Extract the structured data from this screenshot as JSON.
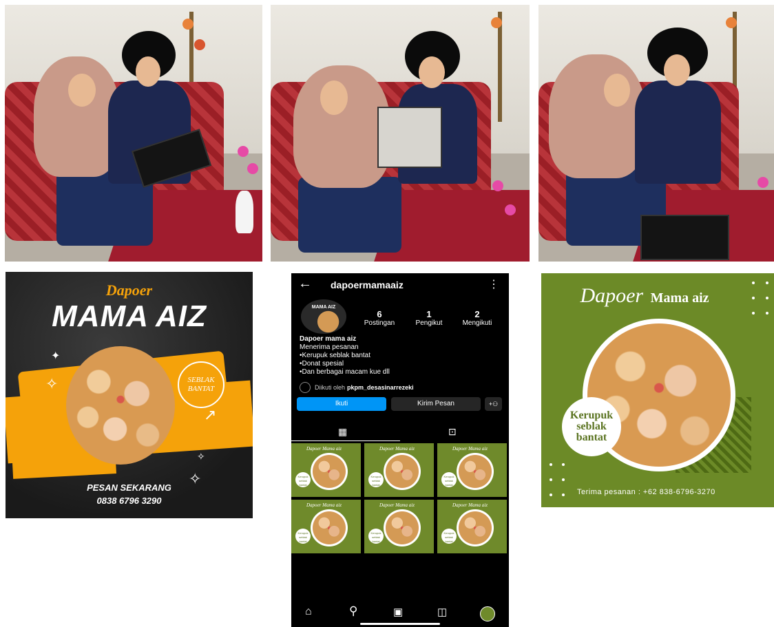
{
  "poster1": {
    "script_title": "Dapoer",
    "title": "MAMA AIZ",
    "badge": "SEBLAK BANTAT",
    "cta": "PESAN SEKARANG",
    "phone": "0838 6796 3290"
  },
  "instagram": {
    "username": "dapoermamaaiz",
    "avatar_text": "MAMA AIZ",
    "stats": [
      {
        "value": "6",
        "label": "Postingan"
      },
      {
        "value": "1",
        "label": "Pengikut"
      },
      {
        "value": "2",
        "label": "Mengikuti"
      }
    ],
    "bio_name": "Dapoer mama aiz",
    "bio_lines": [
      "Menerima pesanan",
      "•Kerupuk seblak bantat",
      "•Donat spesial",
      "•Dan berbagai macam kue dll"
    ],
    "followed_by_prefix": "Diikuti oleh",
    "followed_by_user": "pkpm_desasinarrezeki",
    "follow_button": "Ikuti",
    "message_button": "Kirim Pesan",
    "tile_title": "Dapoer Mama aiz",
    "tile_badge": "Kerupuk seblak bantat"
  },
  "poster3": {
    "script_title": "Dapoer",
    "title": "Mama aiz",
    "badge_line1": "Kerupuk",
    "badge_line2": "seblak",
    "badge_line3": "bantat",
    "footer": "Terima pesanan : +62 838-6796-3270"
  },
  "colors": {
    "accent_orange": "#f5a20a",
    "instagram_blue": "#0095f6",
    "poster_green": "#6c8a27"
  }
}
